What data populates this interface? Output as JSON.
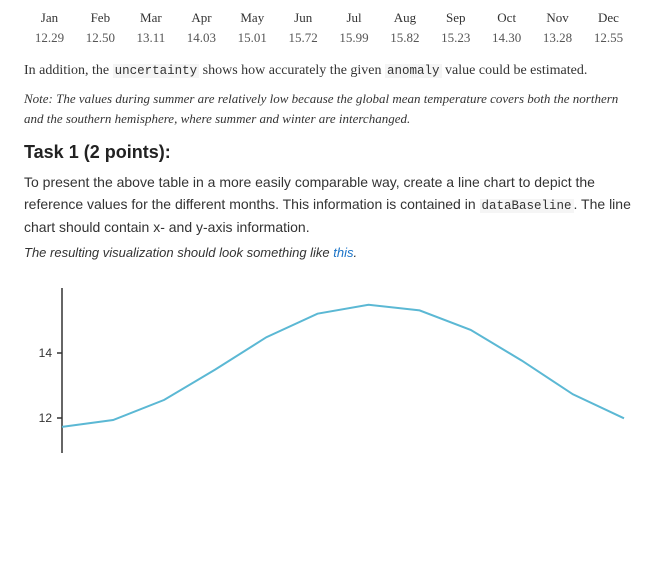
{
  "table": {
    "months": [
      "Jan",
      "Feb",
      "Mar",
      "Apr",
      "May",
      "Jun",
      "Jul",
      "Aug",
      "Sep",
      "Oct",
      "Nov",
      "Dec"
    ],
    "values": [
      "12.29",
      "12.50",
      "13.11",
      "14.03",
      "15.01",
      "15.72",
      "15.99",
      "15.82",
      "15.23",
      "14.30",
      "13.28",
      "12.55"
    ]
  },
  "description": {
    "text1": "In addition, the ",
    "code1": "uncertainty",
    "text2": " shows how accurately the given ",
    "code2": "anomaly",
    "text3": " value could be estimated."
  },
  "note": {
    "text": "Note: The values during summer are relatively low because the global mean temperature covers both the northern and the southern hemisphere, where summer and winter are interchanged."
  },
  "task": {
    "heading": "Task 1 (2 points):",
    "paragraph1": "To present the above table in a more easily comparable way, create a line chart to depict the reference values for the different months. This information is contained in ",
    "code1": "dataBaseline",
    "paragraph2": ". The line chart should contain x- and y-axis information.",
    "italic_text": "The resulting visualization should look something like ",
    "link_text": "this",
    "italic_end": "."
  },
  "chart": {
    "data_points": [
      12.29,
      12.5,
      13.11,
      14.03,
      15.01,
      15.72,
      15.99,
      15.82,
      15.23,
      14.3,
      13.28,
      12.55
    ],
    "y_ticks": [
      "12",
      "14"
    ],
    "y_min": 11.5,
    "y_max": 16.5,
    "accent_color": "#5bb8d4"
  }
}
